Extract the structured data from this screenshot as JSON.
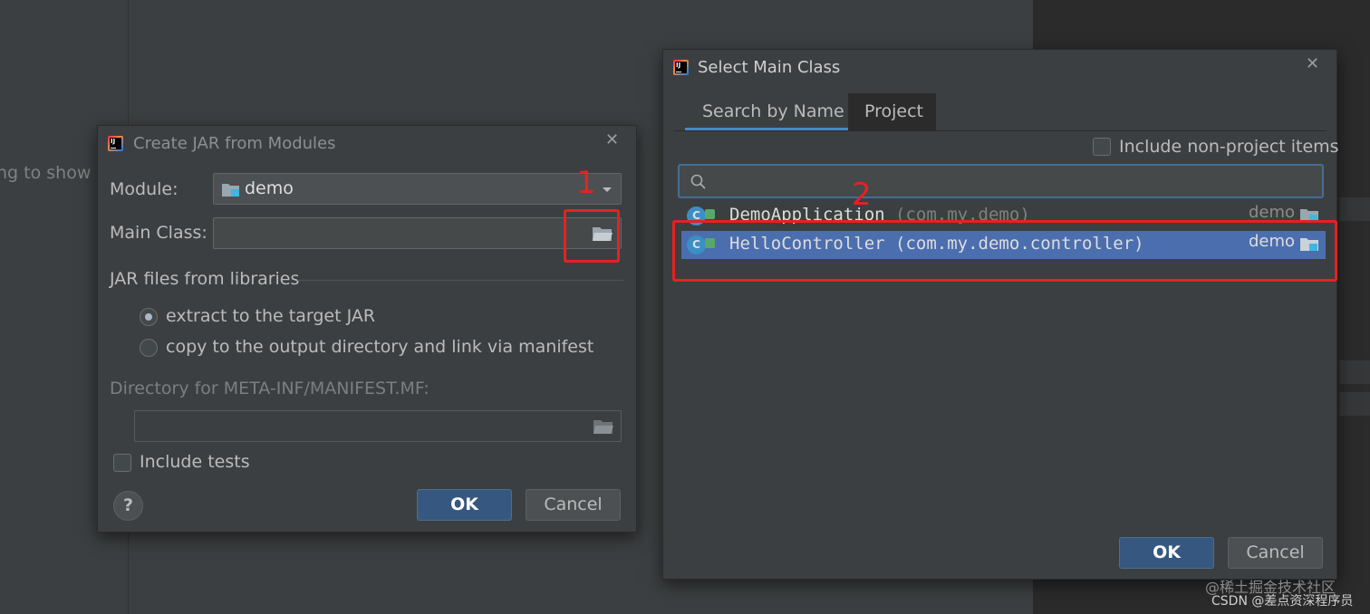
{
  "background": {
    "partial_text": "ng to show"
  },
  "jar_dialog": {
    "title": "Create JAR from Modules",
    "module_label": "Module:",
    "module_value": "demo",
    "main_class_label": "Main Class:",
    "main_class_value": "",
    "libraries_heading": "JAR files from libraries",
    "radio_extract": "extract to the target JAR",
    "radio_copy": "copy to the output directory and link via manifest",
    "selected_option": "extract to the target JAR",
    "manifest_label": "Directory for META-INF/MANIFEST.MF:",
    "manifest_value": "",
    "include_tests_label": "Include tests",
    "include_tests_checked": false,
    "help_symbol": "?",
    "ok_label": "OK",
    "cancel_label": "Cancel"
  },
  "main_class_dialog": {
    "title": "Select Main Class",
    "tabs": [
      {
        "label": "Search by Name",
        "active": true
      },
      {
        "label": "Project",
        "active": false
      }
    ],
    "include_non_project_label": "Include non-project items",
    "include_non_project_checked": false,
    "search_value": "",
    "classes": [
      {
        "name": "DemoApplication",
        "package": "(com.my.demo)",
        "module": "demo",
        "selected": false
      },
      {
        "name": "HelloController",
        "package": "(com.my.demo.controller)",
        "module": "demo",
        "selected": true
      }
    ],
    "ok_label": "OK",
    "cancel_label": "Cancel"
  },
  "annotations": {
    "step1": "1",
    "step2": "2"
  },
  "watermark": {
    "line1": "@稀土掘金技术社区",
    "line2": "CSDN @差点资深程序员"
  },
  "colors": {
    "ok_button": "#365880",
    "selection": "#4b6eaf",
    "annotation": "#e52222",
    "dialog_bg": "#3c3f41"
  }
}
